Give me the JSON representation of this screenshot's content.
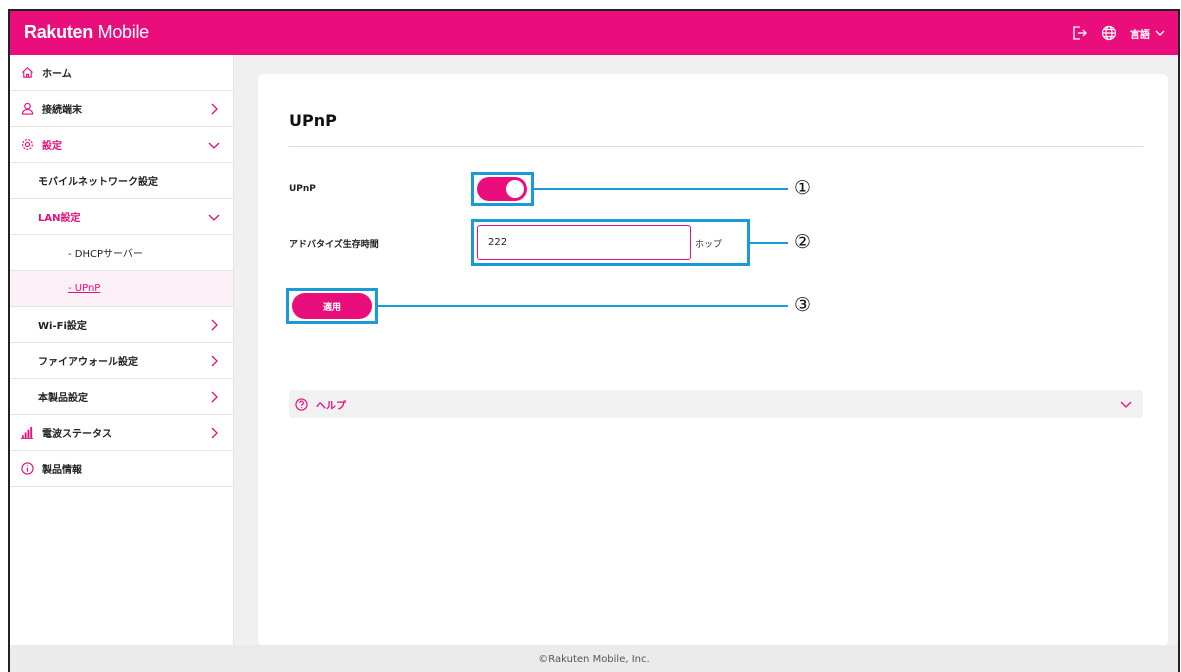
{
  "header": {
    "logo_bold": "Rakuten",
    "logo_light": " Mobile",
    "logout_icon": "logout-icon",
    "globe_icon": "globe-icon",
    "language_label": "言語"
  },
  "sidebar": {
    "items": [
      {
        "label": "ホーム",
        "icon": "home-icon"
      },
      {
        "label": "接続端末",
        "icon": "user-icon"
      },
      {
        "label": "設定",
        "icon": "gear-icon"
      },
      {
        "label": "モバイルネットワーク設定"
      },
      {
        "label": "LAN設定"
      },
      {
        "label": "- DHCPサーバー"
      },
      {
        "label": "- UPnP"
      },
      {
        "label": "Wi-Fi設定"
      },
      {
        "label": "ファイアウォール設定"
      },
      {
        "label": "本製品設定"
      },
      {
        "label": "電波ステータス",
        "icon": "signal-bars-icon"
      },
      {
        "label": "製品情報",
        "icon": "info-icon"
      }
    ]
  },
  "main": {
    "title": "UPnP",
    "upnp_label": "UPnP",
    "upnp_enabled": true,
    "advertise_label": "アドバタイズ生存時間",
    "advertise_value": "222",
    "advertise_unit": "ホップ",
    "apply_label": "適用",
    "help_label": "ヘルプ"
  },
  "annotations": [
    "①",
    "②",
    "③"
  ],
  "footer": {
    "copyright": "©Rakuten Mobile, Inc."
  },
  "colors": {
    "brand": "#ea0e7c",
    "highlight": "#1a9ad8"
  }
}
